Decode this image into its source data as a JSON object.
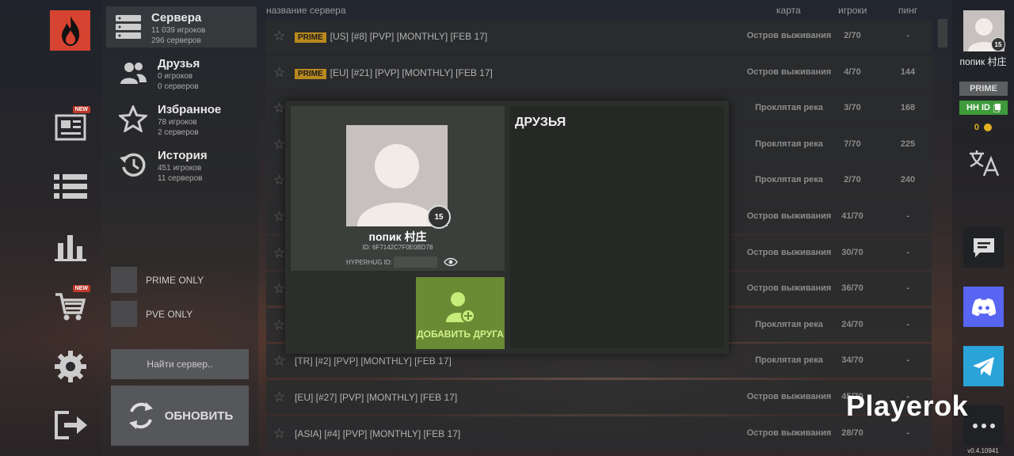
{
  "categories": [
    {
      "title": "Сервера",
      "line1": "11 039 игроков",
      "line2": "296 серверов",
      "icon": "servers-icon"
    },
    {
      "title": "Друзья",
      "line1": "0 игроков",
      "line2": "0 серверов",
      "icon": "friends-icon"
    },
    {
      "title": "Избранное",
      "line1": "78 игроков",
      "line2": "2 серверов",
      "icon": "star-icon"
    },
    {
      "title": "История",
      "line1": "451 игроков",
      "line2": "11 серверов",
      "icon": "history-icon"
    }
  ],
  "filters": {
    "prime_only": "PRIME ONLY",
    "pve_only": "PVE ONLY"
  },
  "find_button": "Найти сервер..",
  "refresh_button": "ОБНОВИТЬ",
  "rail": {
    "new_badge": "NEW"
  },
  "table": {
    "headers": {
      "name": "название сервера",
      "map": "карта",
      "players": "игроки",
      "ping": "пинг"
    },
    "prime_tag": "PRIME",
    "rows": [
      {
        "prime": true,
        "name": "[US] [#8] [PVP] [MONTHLY] [FEB 17]",
        "map": "Остров выживания",
        "players": "2/70",
        "ping": "-"
      },
      {
        "prime": true,
        "name": "[EU] [#21] [PVP] [MONTHLY] [FEB 17]",
        "map": "Остров выживания",
        "players": "4/70",
        "ping": "144"
      },
      {
        "prime": false,
        "name": "",
        "map": "Проклятая река",
        "players": "3/70",
        "ping": "168"
      },
      {
        "prime": false,
        "name": "",
        "map": "Проклятая река",
        "players": "7/70",
        "ping": "225"
      },
      {
        "prime": false,
        "name": "",
        "map": "Проклятая река",
        "players": "2/70",
        "ping": "240"
      },
      {
        "prime": false,
        "name": "",
        "map": "Остров выживания",
        "players": "41/70",
        "ping": "-"
      },
      {
        "prime": false,
        "name": "",
        "map": "Остров выживания",
        "players": "30/70",
        "ping": "-"
      },
      {
        "prime": false,
        "name": "",
        "map": "Остров выживания",
        "players": "36/70",
        "ping": "-"
      },
      {
        "prime": false,
        "name": "",
        "map": "Проклятая река",
        "players": "24/70",
        "ping": "-"
      },
      {
        "prime": false,
        "name": "[TR] [#2] [PVP] [MONTHLY] [FEB 17]",
        "map": "Проклятая река",
        "players": "34/70",
        "ping": "-"
      },
      {
        "prime": false,
        "name": "[EU] [#27] [PVP] [MONTHLY] [FEB 17]",
        "map": "Остров выживания",
        "players": "45/70",
        "ping": "-"
      },
      {
        "prime": false,
        "name": "[ASIA] [#4] [PVP] [MONTHLY] [FEB 17]",
        "map": "Остров выживания",
        "players": "28/70",
        "ping": "-"
      }
    ]
  },
  "modal": {
    "level": "15",
    "player_name": "попик 村庄",
    "player_id": "ID: 6F7142C7F0E0BD78",
    "hyperhug_label": "HYPERHUG ID:",
    "add_friend": "ДОБАВИТЬ ДРУГА",
    "friends_title": "ДРУЗЬЯ"
  },
  "user": {
    "name": "попик 村庄",
    "level": "15",
    "prime": "PRIME",
    "hh_id": "HH ID",
    "coins": "0"
  },
  "version": "v0.4.10941",
  "watermark": "Playerok",
  "colors": {
    "prime": "#e2a626",
    "add_friend": "#6a8a34",
    "hh_id": "#3e9a3a",
    "logo": "#d64431",
    "discord": "#5865f2",
    "telegram": "#2aa3d9"
  }
}
